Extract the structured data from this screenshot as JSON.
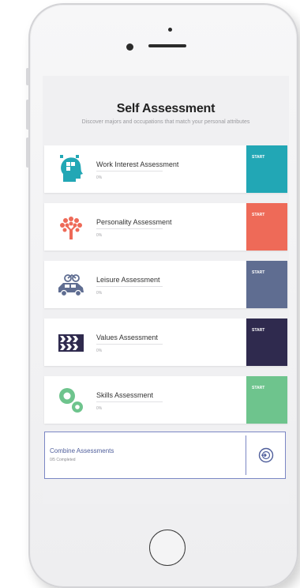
{
  "header": {
    "title": "Self Assessment",
    "subtitle": "Discover majors and occupations that match your personal attributes"
  },
  "assessments": [
    {
      "name": "Work Interest Assessment",
      "progress": "0%",
      "start_label": "START",
      "color": "#22a7b5",
      "icon": "head-puzzle-icon"
    },
    {
      "name": "Personality Assessment",
      "progress": "0%",
      "start_label": "START",
      "color": "#ee6a58",
      "icon": "tree-icon"
    },
    {
      "name": "Leisure Assessment",
      "progress": "0%",
      "start_label": "START",
      "color": "#5f6d91",
      "icon": "car-bike-icon"
    },
    {
      "name": "Values Assessment",
      "progress": "0%",
      "start_label": "START",
      "color": "#2f2a4e",
      "icon": "chevrons-icon"
    },
    {
      "name": "Skills Assessment",
      "progress": "0%",
      "start_label": "START",
      "color": "#6ec48d",
      "icon": "gears-icon"
    }
  ],
  "combine": {
    "title": "Combine Assessments",
    "subtitle": "0/5 Completed",
    "icon": "arrow-circle-icon",
    "accent": "#4f5e9b"
  }
}
